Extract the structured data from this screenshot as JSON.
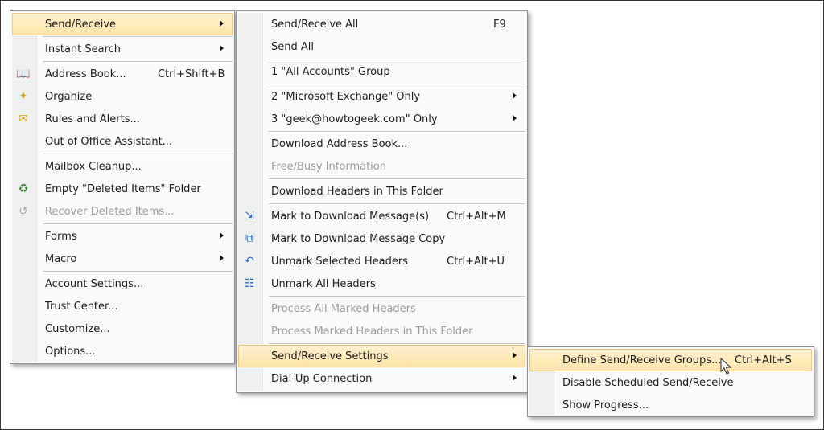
{
  "menu_main": {
    "items": [
      {
        "label": "Send/Receive",
        "submenu": true,
        "highlighted": true
      },
      {
        "label": "Instant Search",
        "submenu": true
      },
      {
        "label": "Address Book...",
        "shortcut": "Ctrl+Shift+B",
        "icon": "address-book-icon"
      },
      {
        "label": "Organize",
        "icon": "organize-icon"
      },
      {
        "label": "Rules and Alerts...",
        "icon": "rules-icon"
      },
      {
        "label": "Out of Office Assistant..."
      },
      {
        "label": "Mailbox Cleanup..."
      },
      {
        "label": "Empty \"Deleted Items\" Folder",
        "icon": "empty-trash-icon"
      },
      {
        "label": "Recover Deleted Items...",
        "icon": "recover-icon",
        "disabled": true
      },
      {
        "label": "Forms",
        "submenu": true
      },
      {
        "label": "Macro",
        "submenu": true
      },
      {
        "label": "Account Settings..."
      },
      {
        "label": "Trust Center..."
      },
      {
        "label": "Customize..."
      },
      {
        "label": "Options..."
      }
    ]
  },
  "menu_send_receive": {
    "items": [
      {
        "label": "Send/Receive All",
        "shortcut": "F9"
      },
      {
        "label": "Send All"
      },
      {
        "label": "1 \"All Accounts\" Group"
      },
      {
        "label": "2 \"Microsoft Exchange\" Only",
        "submenu": true
      },
      {
        "label": "3 \"geek@howtogeek.com\" Only",
        "submenu": true
      },
      {
        "label": "Download Address Book..."
      },
      {
        "label": "Free/Busy Information",
        "disabled": true
      },
      {
        "label": "Download Headers in This Folder"
      },
      {
        "label": "Mark to Download Message(s)",
        "shortcut": "Ctrl+Alt+M",
        "icon": "mark-download-icon"
      },
      {
        "label": "Mark to Download Message Copy",
        "icon": "mark-copy-icon"
      },
      {
        "label": "Unmark Selected Headers",
        "shortcut": "Ctrl+Alt+U",
        "icon": "unmark-icon"
      },
      {
        "label": "Unmark All Headers",
        "icon": "unmark-all-icon"
      },
      {
        "label": "Process All Marked Headers",
        "disabled": true
      },
      {
        "label": "Process Marked Headers in This Folder",
        "disabled": true
      },
      {
        "label": "Send/Receive Settings",
        "submenu": true,
        "highlighted": true
      },
      {
        "label": "Dial-Up Connection",
        "submenu": true
      }
    ]
  },
  "menu_settings": {
    "items": [
      {
        "label": "Define Send/Receive Groups...",
        "shortcut": "Ctrl+Alt+S",
        "highlighted": true
      },
      {
        "label": "Disable Scheduled Send/Receive"
      },
      {
        "label": "Show Progress..."
      }
    ]
  },
  "colors": {
    "highlight": "#fde4a9",
    "highlight_border": "#eec57c",
    "disabled_text": "#9a9a9a"
  }
}
